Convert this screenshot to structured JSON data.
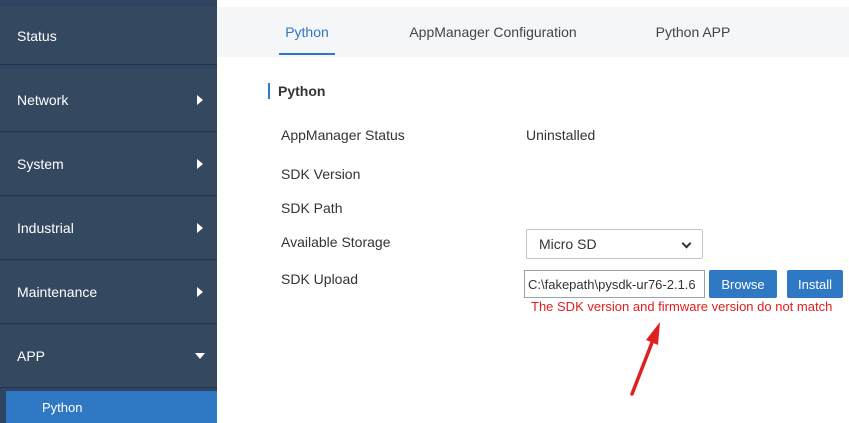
{
  "sidebar": {
    "items": [
      {
        "label": "Status"
      },
      {
        "label": "Network"
      },
      {
        "label": "System"
      },
      {
        "label": "Industrial"
      },
      {
        "label": "Maintenance"
      },
      {
        "label": "APP"
      }
    ],
    "sub_items": [
      {
        "label": "Python"
      }
    ]
  },
  "tabs": [
    {
      "label": "Python"
    },
    {
      "label": "AppManager Configuration"
    },
    {
      "label": "Python APP"
    }
  ],
  "section": {
    "title": "Python"
  },
  "fields": {
    "status_label": "AppManager Status",
    "status_value": "Uninstalled",
    "sdk_version_label": "SDK Version",
    "sdk_path_label": "SDK Path",
    "storage_label": "Available Storage",
    "storage_value": "Micro SD",
    "upload_label": "SDK Upload",
    "upload_file": "C:\\fakepath\\pysdk-ur76-2.1.6",
    "browse_label": "Browse",
    "install_label": "Install",
    "error": "The SDK version and firmware version do not match"
  },
  "colors": {
    "sidebar": "#34495f",
    "accent": "#2f78c4",
    "error": "#e02020",
    "annotation_arrow": "#e02020"
  }
}
